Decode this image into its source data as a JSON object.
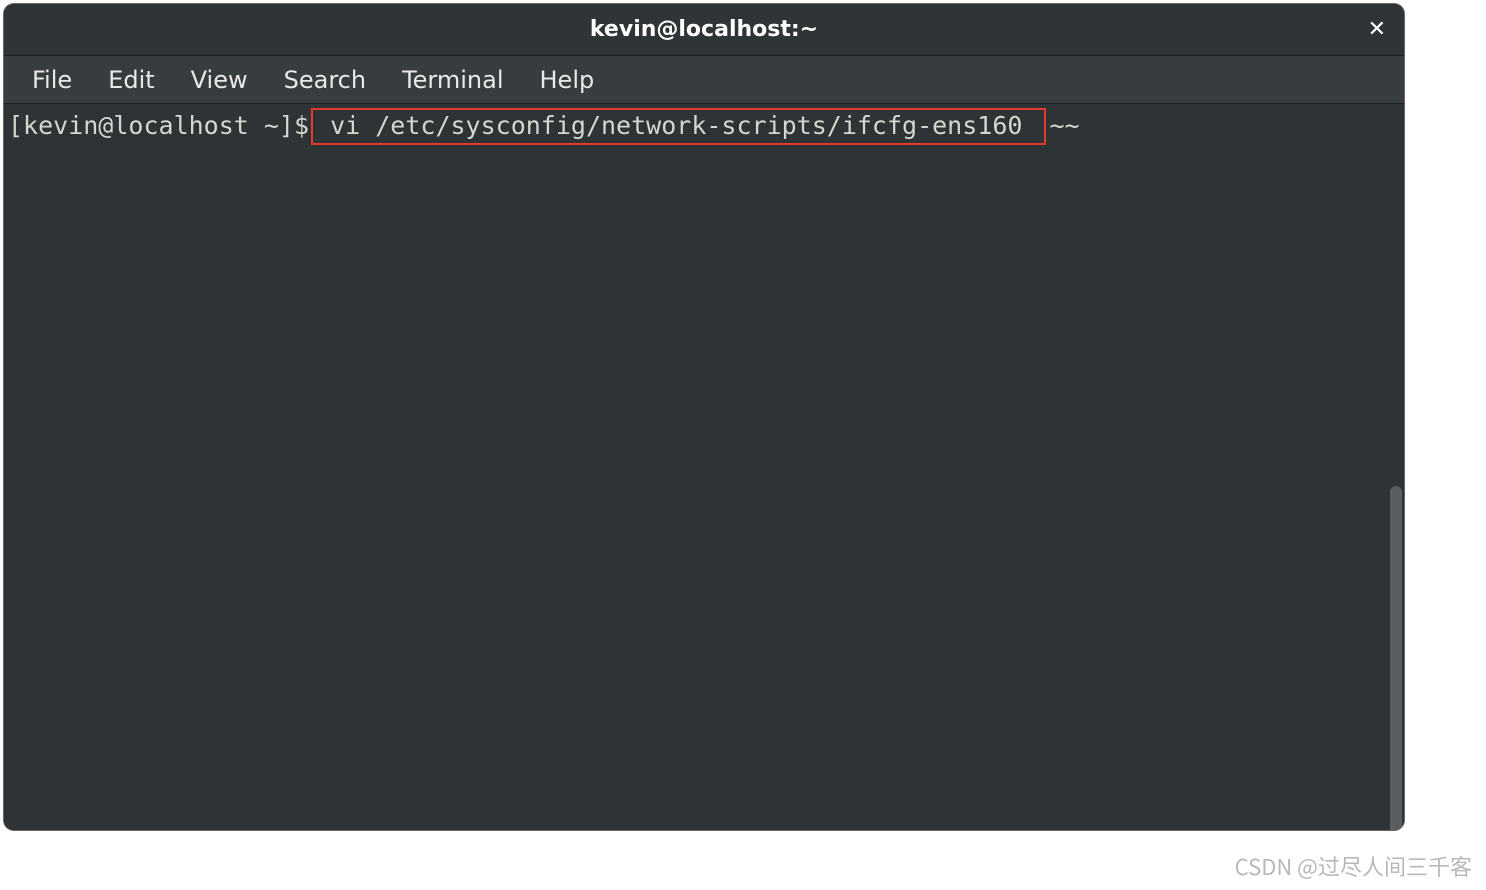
{
  "window": {
    "title": "kevin@localhost:~"
  },
  "menubar": {
    "items": [
      "File",
      "Edit",
      "View",
      "Search",
      "Terminal",
      "Help"
    ]
  },
  "terminal": {
    "prompt": "[kevin@localhost ~]$",
    "command": " vi /etc/sysconfig/network-scripts/ifcfg-ens160 ",
    "trailing": "~~"
  },
  "watermark": "CSDN @过尽人间三千客"
}
